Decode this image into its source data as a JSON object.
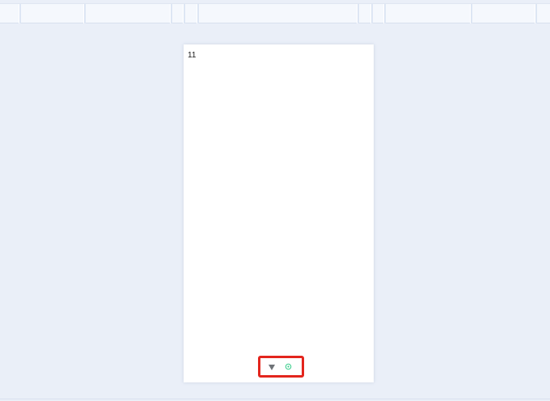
{
  "document": {
    "page_number": "11"
  },
  "controls": {
    "filter_icon": "filter-funnel-icon",
    "settings_icon": "gear-icon",
    "accent_color": "#3ecf8e",
    "highlight_color": "#e3251d"
  }
}
